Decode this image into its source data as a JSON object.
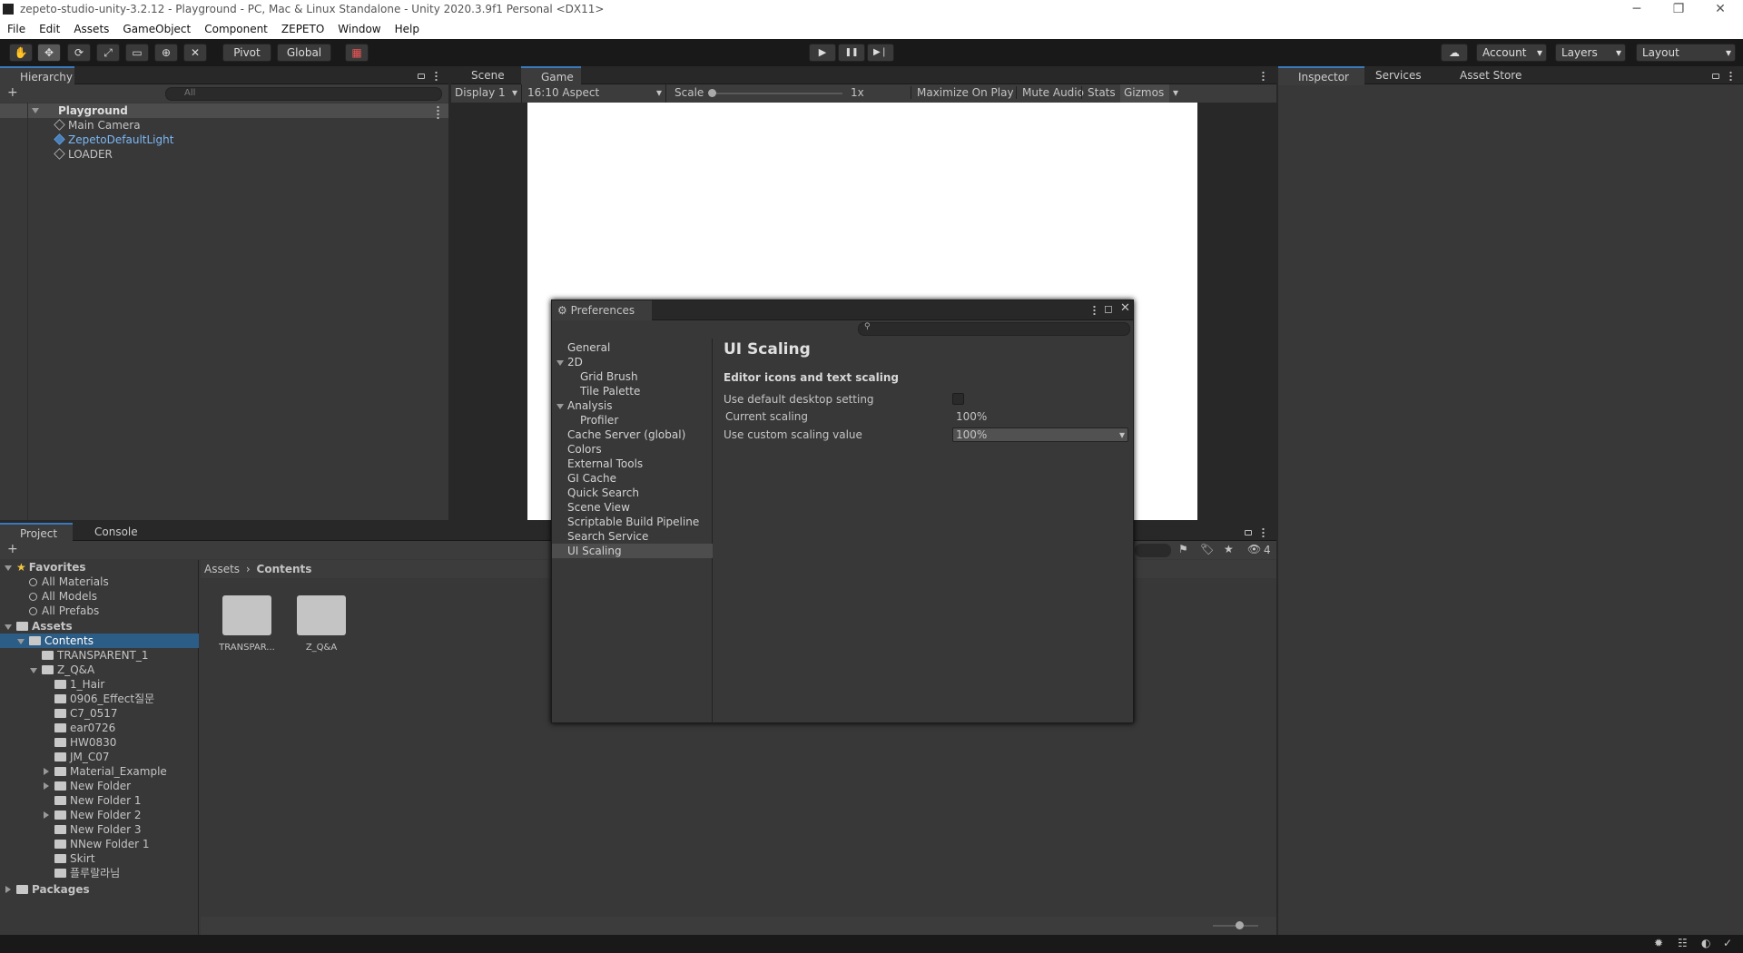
{
  "window": {
    "title": "zepeto-studio-unity-3.2.12 - Playground - PC, Mac & Linux Standalone - Unity 2020.3.9f1 Personal <DX11>",
    "min": "─",
    "restore": "❐",
    "close": "✕"
  },
  "menu": [
    "File",
    "Edit",
    "Assets",
    "GameObject",
    "Component",
    "ZEPETO",
    "Window",
    "Help"
  ],
  "toolbar": {
    "pivot": "Pivot",
    "global": "Global",
    "account": "Account",
    "layers": "Layers",
    "layout": "Layout",
    "play": "▶",
    "pause": "❚❚",
    "step": "▶❘"
  },
  "hierarchy": {
    "tab": "Hierarchy",
    "search_placeholder": "All",
    "scene": "Playground",
    "items": [
      "Main Camera",
      "ZepetoDefaultLight",
      "LOADER"
    ],
    "add": "+"
  },
  "game": {
    "tabs": [
      "Scene",
      "Game"
    ],
    "display": "Display 1",
    "aspect": "16:10 Aspect",
    "scale_label": "Scale",
    "scale_value": "1x",
    "maximize": "Maximize On Play",
    "mute": "Mute Audio",
    "stats": "Stats",
    "gizmos": "Gizmos"
  },
  "inspector": {
    "tabs": [
      "Inspector",
      "Services",
      "Asset Store"
    ]
  },
  "project": {
    "tabs": [
      "Project",
      "Console"
    ],
    "add": "+",
    "badge": "4",
    "favorites": {
      "label": "Favorites",
      "items": [
        "All Materials",
        "All Models",
        "All Prefabs"
      ]
    },
    "assets": {
      "label": "Assets",
      "contents": "Contents",
      "children": [
        "TRANSPARENT_1",
        "Z_Q&A"
      ],
      "qa_children": [
        "1_Hair",
        "0906_Effect질문",
        "C7_0517",
        "ear0726",
        "HW0830",
        "JM_C07",
        "Material_Example",
        "New Folder",
        "New Folder 1",
        "New Folder 2",
        "New Folder 3",
        "NNew Folder 1",
        "Skirt",
        "플루랄라님"
      ]
    },
    "packages": "Packages",
    "breadcrumb": [
      "Assets",
      "Contents"
    ],
    "grid": [
      "TRANSPAR...",
      "Z_Q&A"
    ]
  },
  "preferences": {
    "title": "Preferences",
    "search_placeholder": "",
    "categories": [
      {
        "label": "General",
        "indent": 0
      },
      {
        "label": "2D",
        "indent": 0,
        "fold": true
      },
      {
        "label": "Grid Brush",
        "indent": 1
      },
      {
        "label": "Tile Palette",
        "indent": 1
      },
      {
        "label": "Analysis",
        "indent": 0,
        "fold": true
      },
      {
        "label": "Profiler",
        "indent": 1
      },
      {
        "label": "Cache Server (global)",
        "indent": 0
      },
      {
        "label": "Colors",
        "indent": 0
      },
      {
        "label": "External Tools",
        "indent": 0
      },
      {
        "label": "GI Cache",
        "indent": 0
      },
      {
        "label": "Quick Search",
        "indent": 0
      },
      {
        "label": "Scene View",
        "indent": 0
      },
      {
        "label": "Scriptable Build Pipeline",
        "indent": 0
      },
      {
        "label": "Search Service",
        "indent": 0
      },
      {
        "label": "UI Scaling",
        "indent": 0,
        "selected": true
      }
    ],
    "heading": "UI Scaling",
    "subheading": "Editor icons and text scaling",
    "use_default_label": "Use default desktop setting",
    "use_default_checked": false,
    "current_label": "Current scaling",
    "current_value": "100%",
    "custom_label": "Use custom scaling value",
    "custom_value": "100%"
  }
}
